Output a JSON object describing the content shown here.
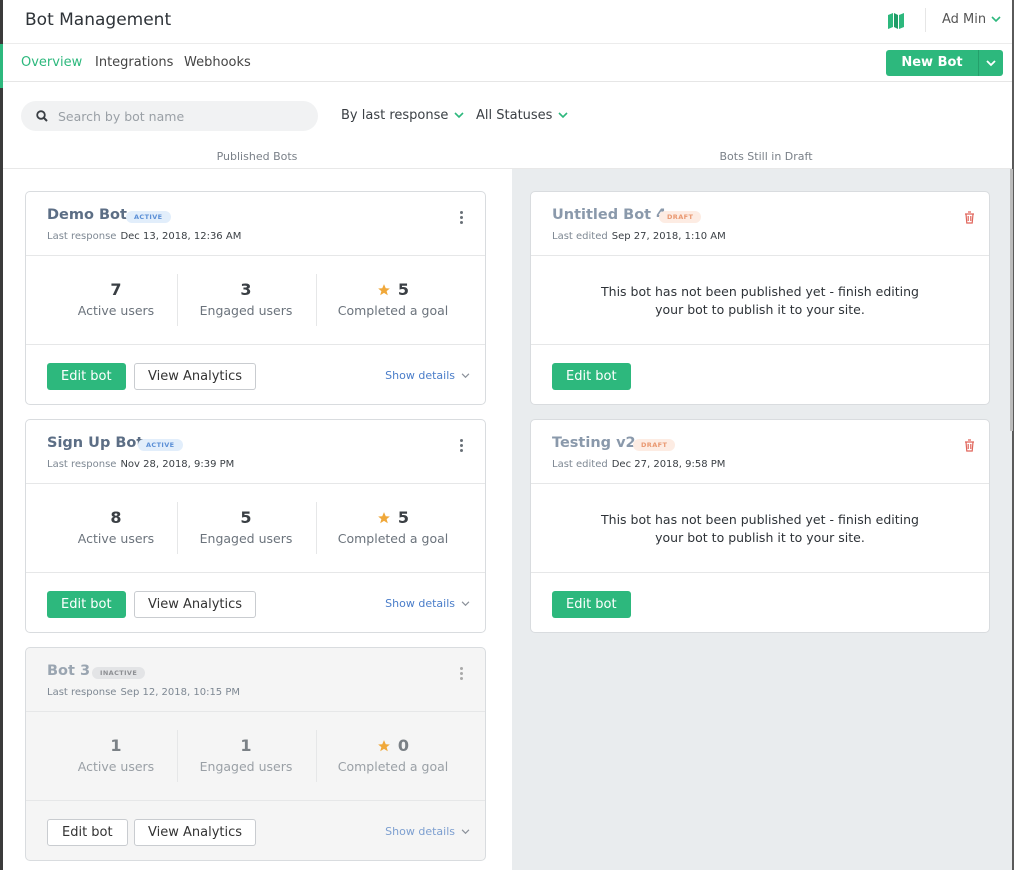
{
  "header": {
    "title": "Bot Management",
    "user_name": "Ad Min",
    "map_icon": "map-icon",
    "accent_color": "#2db87d"
  },
  "nav": {
    "tabs": [
      {
        "label": "Overview",
        "active": true
      },
      {
        "label": "Integrations",
        "active": false
      },
      {
        "label": "Webhooks",
        "active": false
      }
    ],
    "new_bot_label": "New Bot"
  },
  "filters": {
    "search_placeholder": "Search by bot name",
    "sort_label": "By last response",
    "status_label": "All Statuses"
  },
  "columns": {
    "published_heading": "Published Bots",
    "draft_heading": "Bots Still in Draft"
  },
  "published": [
    {
      "name": "Demo Bot",
      "status": "ACTIVE",
      "meta_label": "Last response",
      "meta_value": "Dec 13, 2018, 12:36 AM",
      "stats": [
        {
          "value": "7",
          "label": "Active users"
        },
        {
          "value": "3",
          "label": "Engaged users"
        },
        {
          "value": "5",
          "label": "Completed a goal"
        }
      ],
      "edit_label": "Edit bot",
      "analytics_label": "View Analytics",
      "details_label": "Show details"
    },
    {
      "name": "Sign Up Bot",
      "status": "ACTIVE",
      "meta_label": "Last response",
      "meta_value": "Nov 28, 2018, 9:39 PM",
      "stats": [
        {
          "value": "8",
          "label": "Active users"
        },
        {
          "value": "5",
          "label": "Engaged users"
        },
        {
          "value": "5",
          "label": "Completed a goal"
        }
      ],
      "edit_label": "Edit bot",
      "analytics_label": "View Analytics",
      "details_label": "Show details"
    },
    {
      "name": "Bot 3",
      "status": "INACTIVE",
      "meta_label": "Last response",
      "meta_value": "Sep 12, 2018, 10:15 PM",
      "stats": [
        {
          "value": "1",
          "label": "Active users"
        },
        {
          "value": "1",
          "label": "Engaged users"
        },
        {
          "value": "0",
          "label": "Completed a goal"
        }
      ],
      "edit_label": "Edit bot",
      "analytics_label": "View Analytics",
      "details_label": "Show details"
    }
  ],
  "drafts": [
    {
      "name": "Untitled Bot 4",
      "status": "DRAFT",
      "meta_label": "Last edited",
      "meta_value": "Sep 27, 2018, 1:10 AM",
      "message": "This bot has not been published yet - finish editing your bot to publish it to your site.",
      "edit_label": "Edit bot"
    },
    {
      "name": "Testing v2",
      "status": "DRAFT",
      "meta_label": "Last edited",
      "meta_value": "Dec 27, 2018, 9:58 PM",
      "message": "This bot has not been published yet - finish editing your bot to publish it to your site.",
      "edit_label": "Edit bot"
    }
  ]
}
